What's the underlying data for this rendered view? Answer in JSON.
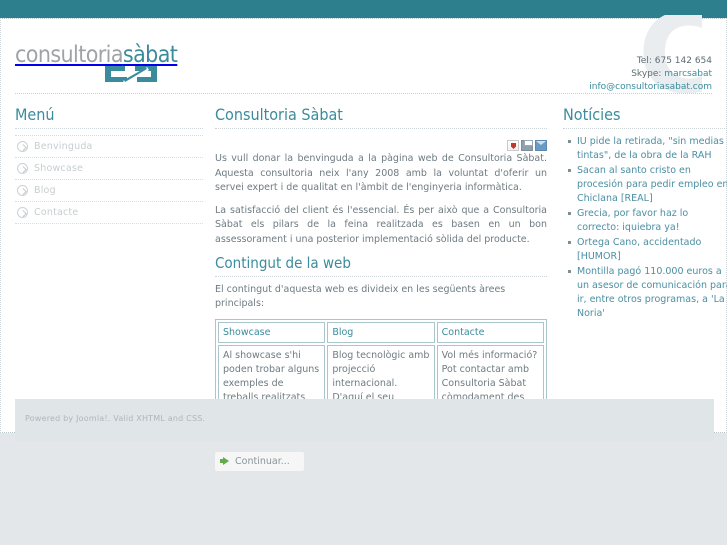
{
  "site": {
    "logo_part1": "consultoria",
    "logo_part2": "sàbat",
    "watermark_letter": "C"
  },
  "header": {
    "tel": "Tel: 675 142 654",
    "skype_label": "Skype: ",
    "skype_value": "marcsabat",
    "email": "info@consultoriasabat.com"
  },
  "sidebar": {
    "title": "Menú",
    "items": [
      {
        "label": "Benvinguda"
      },
      {
        "label": "Showcase"
      },
      {
        "label": "Blog"
      },
      {
        "label": "Contacte"
      }
    ]
  },
  "main": {
    "title": "Consultoria Sàbat",
    "icons": [
      "pdf-icon",
      "print-icon",
      "email-icon"
    ],
    "paragraphs": [
      "Us vull donar la benvinguda a la pàgina web de Consultoria Sàbat. Aquesta consultoria neix l'any 2008 amb la voluntat d'oferir un servei expert i de qualitat en l'àmbit de l'enginyeria informàtica.",
      "La satisfacció del client és l'essencial. És per això que a Consultoria Sàbat els pilars de la feina realitzada es basen en un bon assessorament i una posterior implementació sòlida del producte."
    ],
    "subtitle": "Contingut de la web",
    "lead": "El contingut d'aquesta web es divideix en les següents àrees principals:",
    "table": {
      "headers": [
        "Showcase",
        "Blog",
        "Contacte"
      ],
      "cells": [
        "Al showcase s'hi poden trobar alguns exemples de treballs realitzats per Consultoria Sàbat",
        "Blog tecnològic amb projecció internacional. D'aquí el seu contingut en anglès",
        "Vol més informació? Pot contactar amb Consultoria Sàbat còmodament des d'aquesta secció"
      ]
    },
    "readmore": "Continuar..."
  },
  "news": {
    "title": "Notícies",
    "items": [
      "IU pide la retirada, \"sin medias tintas\", de la obra de la RAH",
      "Sacan al santo cristo en procesión para pedir empleo en Chiclana [REAL]",
      "Grecia, por favor haz lo correcto: iquiebra ya!",
      "Ortega Cano, accidentado [HUMOR]",
      "Montilla pagó 110.000 euros a un asesor de comunicación para ir, entre otros programas, a 'La Noria'"
    ]
  },
  "footer": {
    "text": "Powered by Joomla!. Valid XHTML and CSS."
  },
  "colors": {
    "teal": "#2d7f8d",
    "heading": "#3a8c9c",
    "body_text": "#6e7b81",
    "page_bg": "#e3e7e9",
    "footer_bg": "#e0e5e8"
  }
}
